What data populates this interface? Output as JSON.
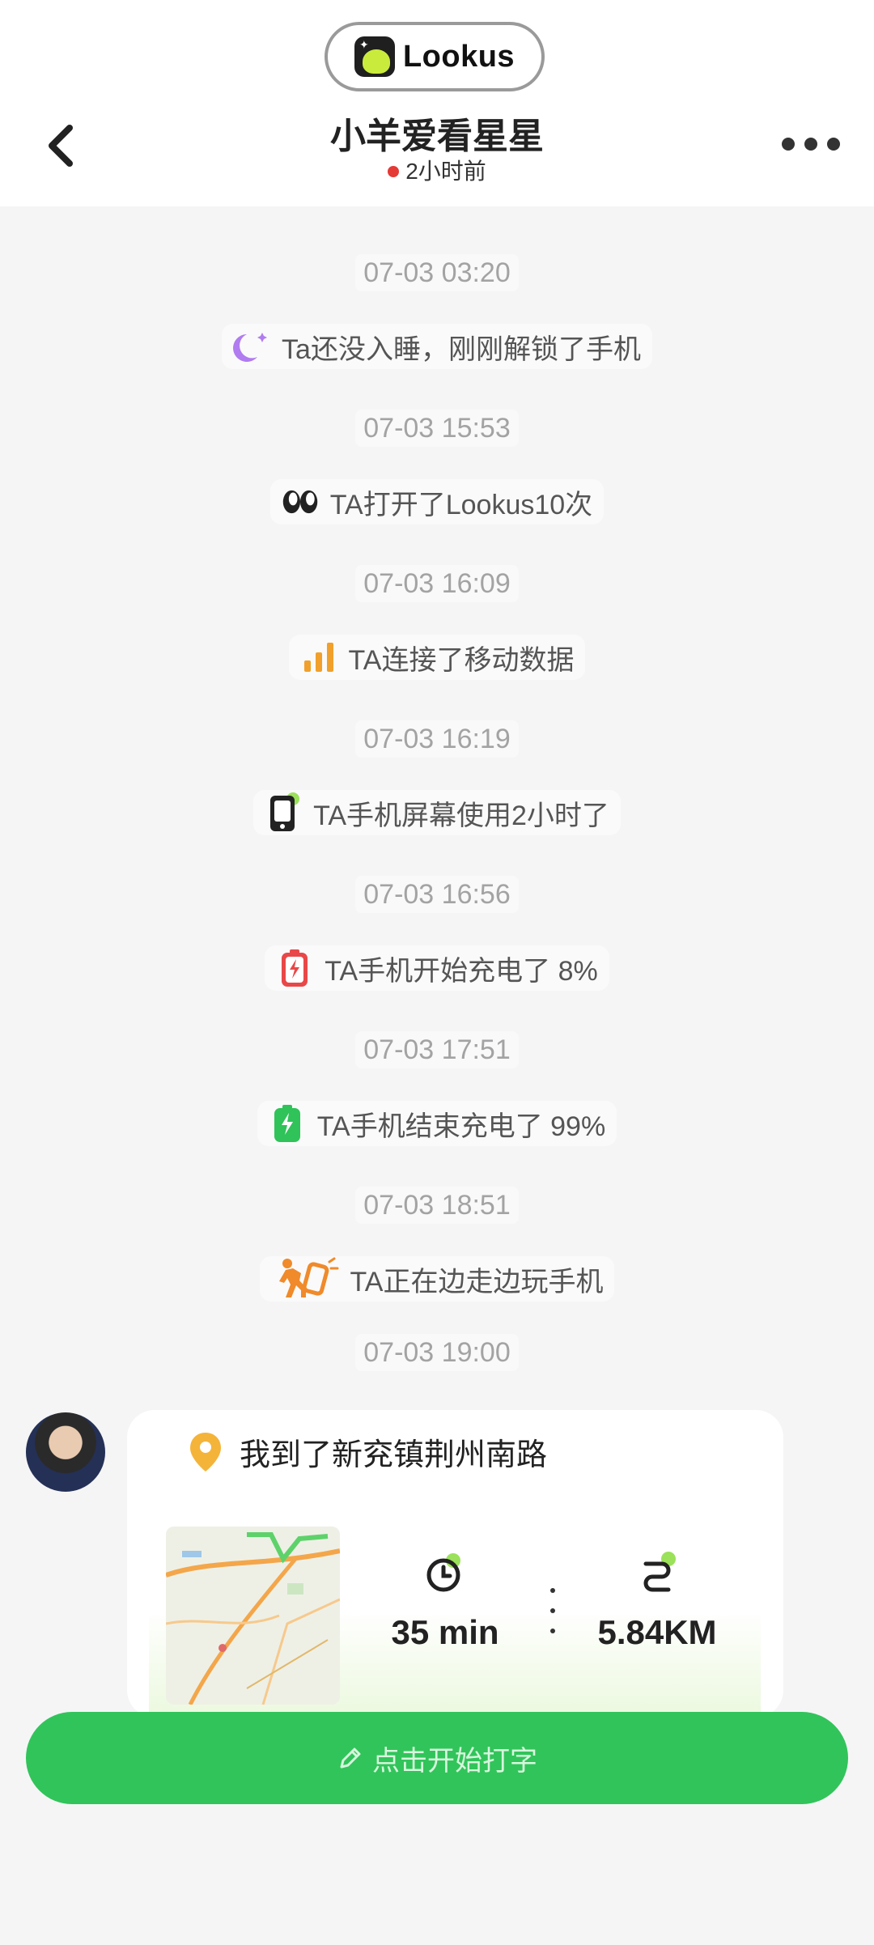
{
  "header": {
    "brand": "Lookus",
    "title": "小羊爱看星星",
    "status": "2小时前"
  },
  "events": [
    {
      "time": "07-03 03:20",
      "text": "Ta还没入睡，刚刚解锁了手机",
      "icon": "moon-icon"
    },
    {
      "time": "07-03 15:53",
      "text": "TA打开了Lookus10次",
      "icon": "eyes-icon"
    },
    {
      "time": "07-03 16:09",
      "text": "TA连接了移动数据",
      "icon": "signal-icon"
    },
    {
      "time": "07-03 16:19",
      "text": "TA手机屏幕使用2小时了",
      "icon": "phone-icon"
    },
    {
      "time": "07-03 16:56",
      "text": "TA手机开始充电了 8%",
      "icon": "battery-low-icon"
    },
    {
      "time": "07-03 17:51",
      "text": "TA手机结束充电了 99%",
      "icon": "battery-full-icon"
    },
    {
      "time": "07-03 18:51",
      "text": "TA正在边走边玩手机",
      "icon": "walking-icon"
    }
  ],
  "location_card": {
    "time": "07-03 19:00",
    "text": "我到了新兖镇荆州南路",
    "duration": "35 min",
    "distance": "5.84KM"
  },
  "input": {
    "label": "点击开始打字"
  },
  "colors": {
    "accent": "#31c45a",
    "status_dot": "#e53935"
  }
}
